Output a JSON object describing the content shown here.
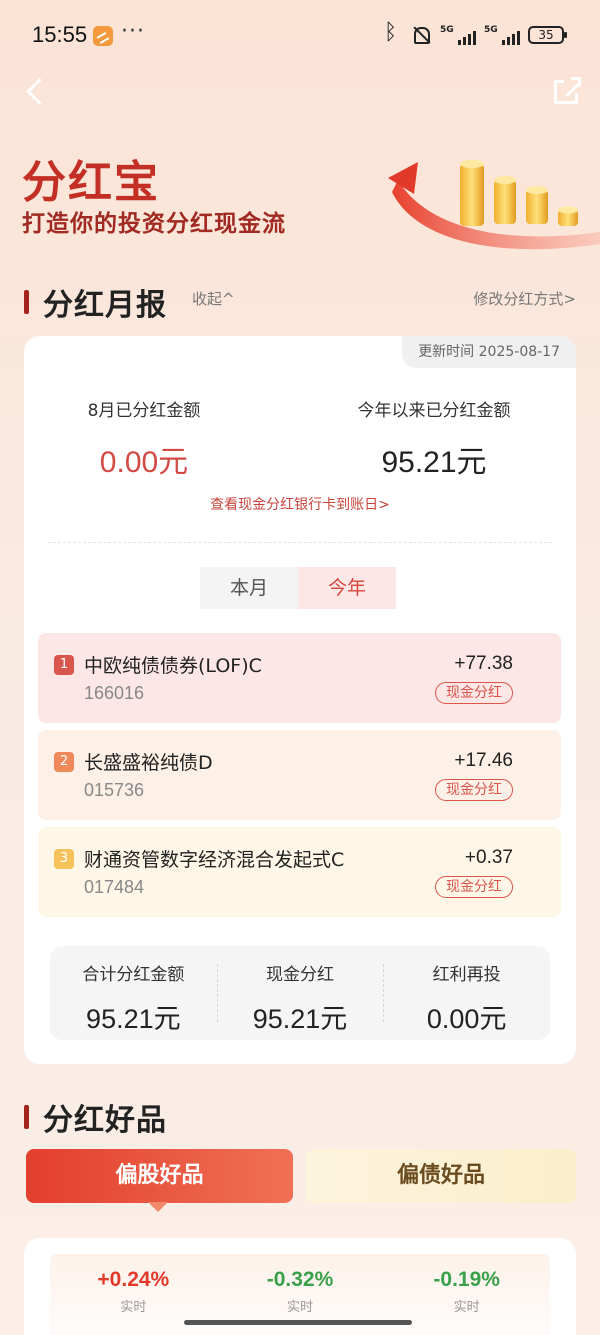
{
  "status": {
    "time": "15:55",
    "dots": "···",
    "net1": "5G",
    "net2": "5G",
    "battery": "35"
  },
  "hero": {
    "title": "分红宝",
    "subtitle": "打造你的投资分红现金流"
  },
  "report": {
    "section_title": "分红月报",
    "collapse_label": "收起^",
    "modify_label": "修改分红方式>",
    "update_time": "更新时间 2025-08-17",
    "month_label": "8月已分红金额",
    "month_value": "0.00元",
    "year_label": "今年以来已分红金额",
    "year_value": "95.21元",
    "bank_link": "查看现金分红银行卡到账日>",
    "tabs": {
      "month": "本月",
      "year": "今年"
    },
    "selected_tab": "今年",
    "funds": [
      {
        "rank": "1",
        "name": "中欧纯债债券(LOF)C",
        "code": "166016",
        "amount": "+77.38",
        "tag": "现金分红"
      },
      {
        "rank": "2",
        "name": "长盛盛裕纯债D",
        "code": "015736",
        "amount": "+17.46",
        "tag": "现金分红"
      },
      {
        "rank": "3",
        "name": "财通资管数字经济混合发起式C",
        "code": "017484",
        "amount": "+0.37",
        "tag": "现金分红"
      }
    ],
    "summary": [
      {
        "label": "合计分红金额",
        "value": "95.21元"
      },
      {
        "label": "现金分红",
        "value": "95.21元"
      },
      {
        "label": "红利再投",
        "value": "0.00元"
      }
    ]
  },
  "goods": {
    "section_title": "分红好品",
    "tab_stock": "偏股好品",
    "tab_bond": "偏债好品",
    "selected_tab": "偏股好品",
    "items": [
      {
        "pct": "+0.24%",
        "label": "实时",
        "direction": "up"
      },
      {
        "pct": "-0.32%",
        "label": "实时",
        "direction": "down"
      },
      {
        "pct": "-0.19%",
        "label": "实时",
        "direction": "down"
      }
    ]
  },
  "colors": {
    "brand_red": "#c42f25",
    "up_red": "#e2392a",
    "down_green": "#3aa04a"
  }
}
